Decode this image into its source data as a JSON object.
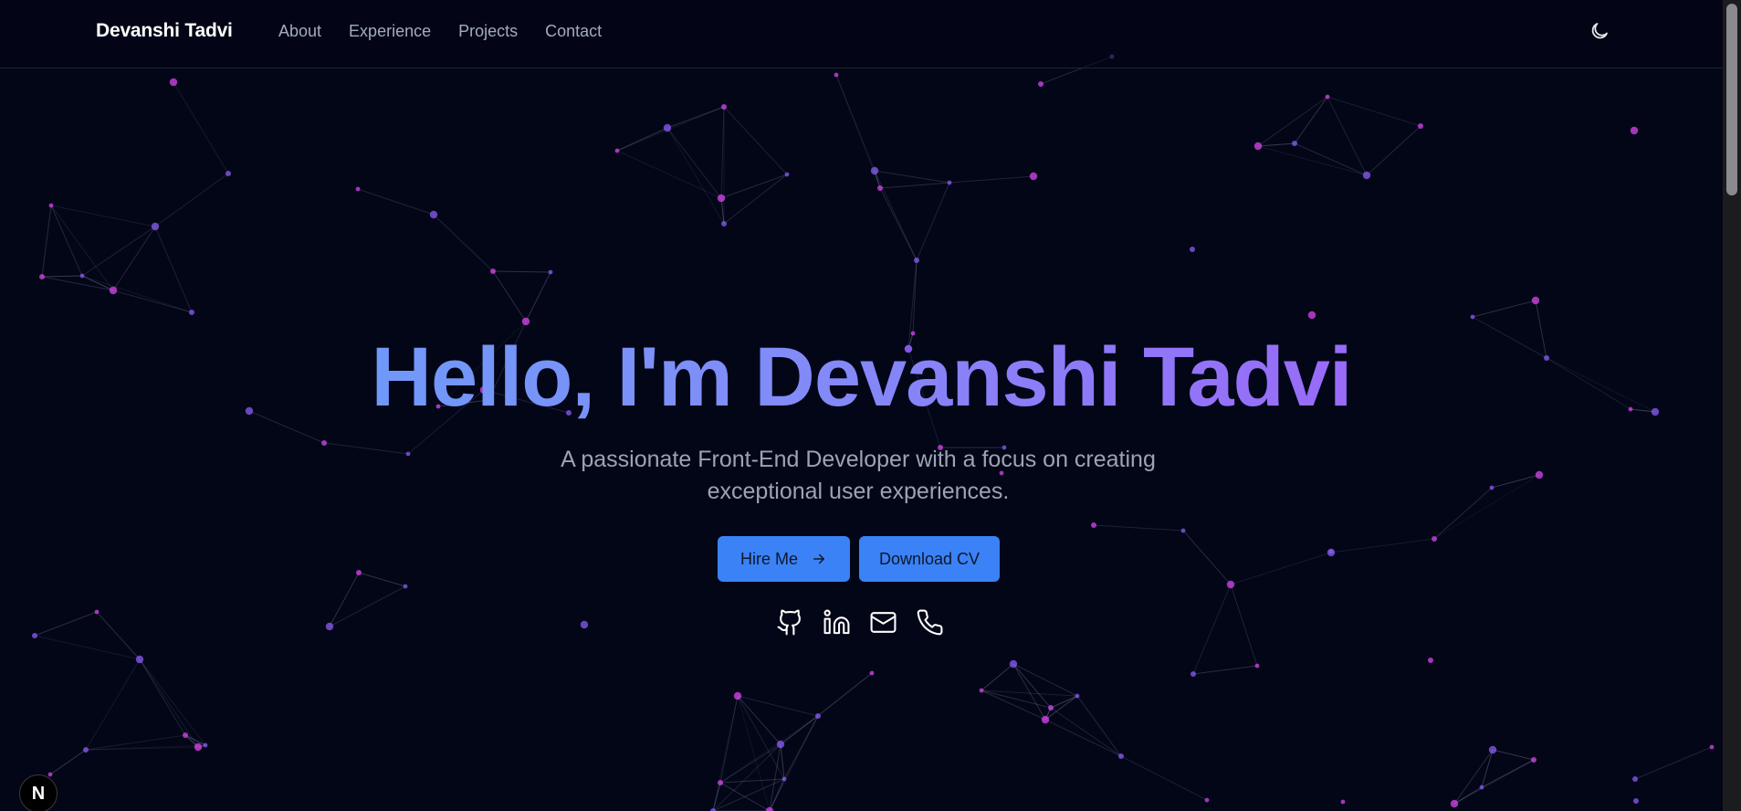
{
  "nav": {
    "brand": "Devanshi Tadvi",
    "links": [
      "About",
      "Experience",
      "Projects",
      "Contact"
    ],
    "theme_icon": "moon-icon"
  },
  "hero": {
    "title": "Hello, I'm Devanshi Tadvi",
    "subtitle": "A passionate Front-End Developer with a focus on creating exceptional user experiences.",
    "hire_label": "Hire Me",
    "cv_label": "Download CV"
  },
  "social": [
    "github-icon",
    "linkedin-icon",
    "mail-icon",
    "phone-icon"
  ],
  "badge": {
    "label": "N"
  },
  "colors": {
    "background": "#030617",
    "accent": "#3b82f6",
    "gradient_start": "#60a5fa",
    "gradient_end": "#a855f7",
    "particle_pink": "#d946ef",
    "particle_purple": "#8b5cf6"
  }
}
